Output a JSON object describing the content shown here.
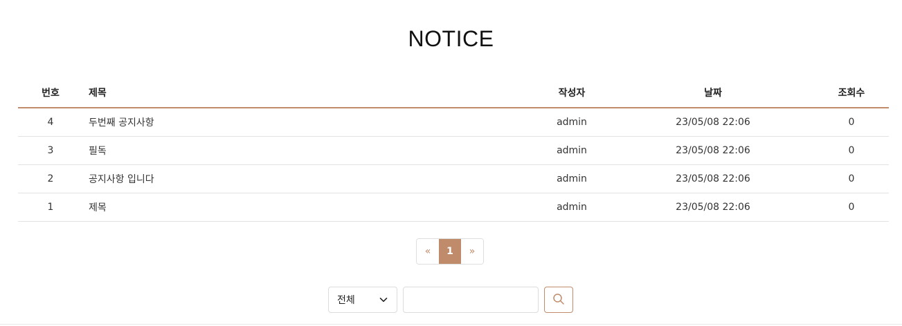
{
  "page": {
    "title": "NOTICE"
  },
  "table": {
    "headers": {
      "num": "번호",
      "title": "제목",
      "writer": "작성자",
      "date": "날짜",
      "views": "조회수"
    },
    "rows": [
      {
        "num": "4",
        "title": "두번째 공지사항",
        "writer": "admin",
        "date": "23/05/08 22:06",
        "views": "0"
      },
      {
        "num": "3",
        "title": "필독",
        "writer": "admin",
        "date": "23/05/08 22:06",
        "views": "0"
      },
      {
        "num": "2",
        "title": "공지사항 입니다",
        "writer": "admin",
        "date": "23/05/08 22:06",
        "views": "0"
      },
      {
        "num": "1",
        "title": "제목",
        "writer": "admin",
        "date": "23/05/08 22:06",
        "views": "0"
      }
    ]
  },
  "pagination": {
    "prev": "«",
    "current": "1",
    "next": "»"
  },
  "search": {
    "select_value": "전체",
    "input_value": "",
    "input_placeholder": ""
  },
  "colors": {
    "accent": "#c08b6a"
  },
  "icons": {
    "select_arrow": "chevron-down-icon",
    "search": "search-icon"
  }
}
